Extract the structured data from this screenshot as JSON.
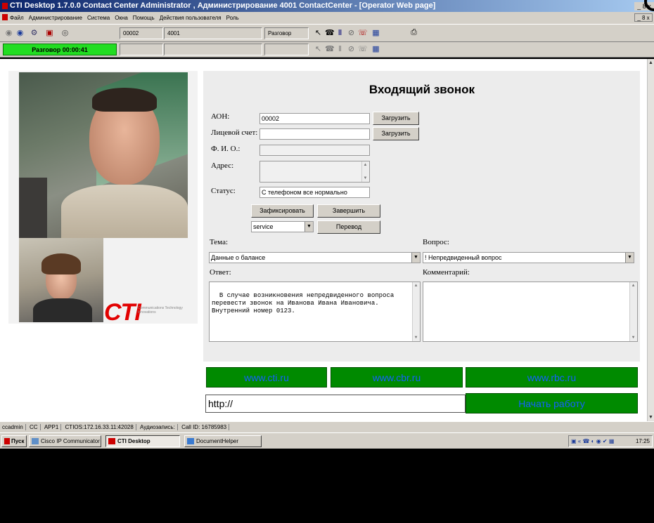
{
  "window": {
    "title": "CTI Desktop 1.7.0.0  Contact Center Administrator ,  Администрирование  4001  ContactCenter - [Operator Web page]",
    "restore_buttons": "_ 8 x"
  },
  "menu": {
    "items": [
      "Файл",
      "Администрирование",
      "Система",
      "Окна",
      "Помощь",
      "Действия пользователя",
      "Роль"
    ],
    "right_buttons": "_ 8 x"
  },
  "toolbar": {
    "extension": "00002",
    "number": "4001",
    "state": "Разговор",
    "call_status": "Разговор 00:00:41"
  },
  "form": {
    "heading": "Входящий звонок",
    "aon_label": "АОН:",
    "aon_value": "00002",
    "load_button": "Загрузить",
    "account_label": "Лицевой счет:",
    "account_value": "",
    "load_button2": "Загрузить",
    "fio_label": "Ф. И. О.:",
    "fio_value": "",
    "address_label": "Адрес:",
    "address_value": "",
    "status_label": "Статус:",
    "status_value": "С телефоном все нормально",
    "fix_button": "Зафиксировать",
    "finish_button": "Завершить",
    "service_select": "service",
    "transfer_button": "Перевод",
    "topic_label": "Тема:",
    "topic_value": "Данные о балансе",
    "question_label": "Вопрос:",
    "question_value": "! Непредвиденный вопрос",
    "answer_label": "Ответ:",
    "answer_text": "В случае возникновения непредвиденного вопроса\nперевести звонок на Иванова Ивана Ивановича.\nВнутренний номер 0123.",
    "comment_label": "Комментарий:",
    "comment_text": ""
  },
  "logo": {
    "text": "CTI",
    "tagline": "Communications Technology Innovations"
  },
  "links": [
    "www.cti.ru",
    "www.cbr.ru",
    "www.rbc.ru"
  ],
  "url_field": "http://",
  "start_button": "Начать работу",
  "statusbar": {
    "items": [
      "ccadmin",
      "CC",
      "APP1",
      "CTIOS:172.16.33.11:42028",
      "Аудиозапись:",
      "Call ID: 16785983"
    ]
  },
  "taskbar": {
    "start": "Пуск",
    "tasks": [
      "Cisco IP Communicator",
      "CTI Desktop",
      "DocumentHelper"
    ],
    "clock": "17:25"
  },
  "colors": {
    "call_status_bg": "#22dd22",
    "link_bg": "#008a00",
    "link_text": "#1560ff",
    "logo_red": "#e20000"
  }
}
